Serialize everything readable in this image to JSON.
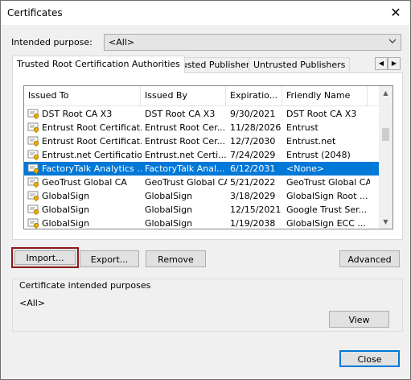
{
  "window": {
    "title": "Certificates",
    "close_glyph": "✕"
  },
  "intended_purpose": {
    "label": "Intended purpose:",
    "value": "<All>"
  },
  "tabs": [
    {
      "label": "Trusted Root Certification Authorities",
      "active": true
    },
    {
      "label": "Trusted Publishers",
      "active": false
    },
    {
      "label": "Untrusted Publishers",
      "active": false
    }
  ],
  "tab_scroll": {
    "left": "◀",
    "right": "▶"
  },
  "list": {
    "columns": [
      "Issued To",
      "Issued By",
      "Expiratio...",
      "Friendly Name"
    ],
    "rows": [
      {
        "issued_to": "DST Root CA X3",
        "issued_by": "DST Root CA X3",
        "expiration": "9/30/2021",
        "friendly": "DST Root CA X3",
        "selected": false
      },
      {
        "issued_to": "Entrust Root Certificat...",
        "issued_by": "Entrust Root Cer...",
        "expiration": "11/28/2026",
        "friendly": "Entrust",
        "selected": false
      },
      {
        "issued_to": "Entrust Root Certificat...",
        "issued_by": "Entrust Root Cer...",
        "expiration": "12/7/2030",
        "friendly": "Entrust.net",
        "selected": false
      },
      {
        "issued_to": "Entrust.net Certificatio...",
        "issued_by": "Entrust.net Certi...",
        "expiration": "7/24/2029",
        "friendly": "Entrust (2048)",
        "selected": false
      },
      {
        "issued_to": "FactoryTalk Analytics ...",
        "issued_by": "FactoryTalk Anal...",
        "expiration": "6/12/2031",
        "friendly": "<None>",
        "selected": true
      },
      {
        "issued_to": "GeoTrust Global CA",
        "issued_by": "GeoTrust Global CA",
        "expiration": "5/21/2022",
        "friendly": "GeoTrust Global CA",
        "selected": false
      },
      {
        "issued_to": "GlobalSign",
        "issued_by": "GlobalSign",
        "expiration": "3/18/2029",
        "friendly": "GlobalSign Root ...",
        "selected": false
      },
      {
        "issued_to": "GlobalSign",
        "issued_by": "GlobalSign",
        "expiration": "12/15/2021",
        "friendly": "Google Trust Ser...",
        "selected": false
      },
      {
        "issued_to": "GlobalSign",
        "issued_by": "GlobalSign",
        "expiration": "1/19/2038",
        "friendly": "GlobalSign ECC ...",
        "selected": false
      }
    ]
  },
  "buttons": {
    "import": "Import...",
    "export": "Export...",
    "remove": "Remove",
    "advanced": "Advanced",
    "view": "View",
    "close": "Close"
  },
  "purposes": {
    "label": "Certificate intended purposes",
    "value": "<All>"
  },
  "colors": {
    "selection": "#0078d7",
    "import_highlight": "#8b1a1a",
    "default_border": "#0078d7"
  }
}
